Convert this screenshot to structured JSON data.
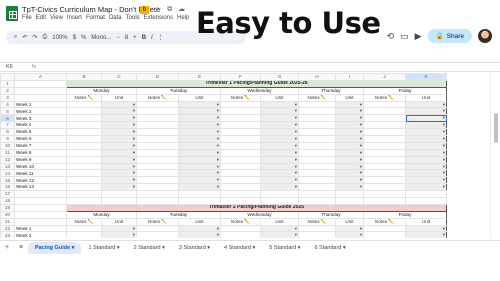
{
  "overlay": {
    "headline": "Easy to Use"
  },
  "window": {
    "doc_title": "TpT-Civics Curriculum Map - Don't Delete",
    "menu": [
      "File",
      "Edit",
      "View",
      "Insert",
      "Format",
      "Data",
      "Tools",
      "Extensions",
      "Help"
    ],
    "share_label": "Share"
  },
  "toolbar": {
    "zoom": "100%",
    "font": "Mono...",
    "font_size": "8"
  },
  "formula": {
    "cell_ref": "K6",
    "fx": "fx"
  },
  "columns": [
    "",
    "A",
    "B",
    "C",
    "D",
    "E",
    "F",
    "G",
    "H",
    "I",
    "J",
    "K"
  ],
  "sheet": {
    "section1": {
      "title": "Trimester 1 Pacing/Planning Guide 2025-26",
      "days": [
        "Monday",
        "Tuesday",
        "Wednesday",
        "Thursday",
        "Friday"
      ],
      "notes_label": "Notes ✏️",
      "unit_label": "Unit",
      "weeks": [
        "Week 1",
        "Week 2",
        "Week 3",
        "Week 4",
        "Week 5",
        "Week 6",
        "Week 7",
        "Week 8",
        "Week 9",
        "Week 10",
        "Week 11",
        "Week 12",
        "Week 13"
      ]
    },
    "section2": {
      "title": "Trimaster 2 Pacing/Planning Guide 2025",
      "days": [
        "Monday",
        "Tuesday",
        "Wednesday",
        "Thursday",
        "Friday"
      ],
      "notes_label": "Notes ✏️",
      "unit_label": "Unit",
      "weeks": [
        "Week 1",
        "Week 2"
      ]
    }
  },
  "tabs": [
    "Pacing Guide",
    "1 Standard",
    "2 Standard",
    "3 Standard",
    "4 Standard",
    "5 Standard",
    "6 Standard"
  ]
}
